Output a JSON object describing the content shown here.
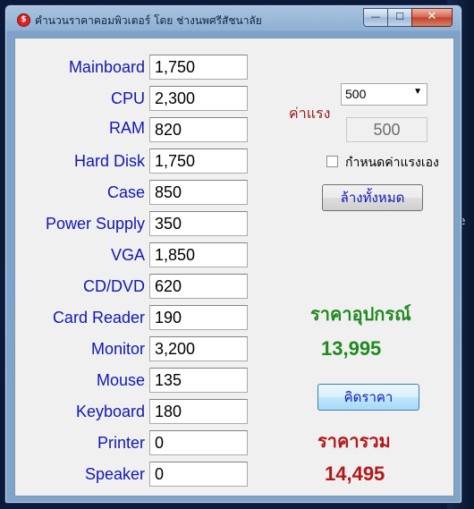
{
  "window": {
    "title": "คำนวนราคาคอมพิวเตอร์ โดย ช่างนพศรีสัชนาลัย",
    "icon_glyph": "$",
    "min_glyph": "—",
    "max_glyph": "☐",
    "close_glyph": "✕"
  },
  "background_glyph": "e",
  "components": [
    {
      "label": "Mainboard",
      "value": "1,750"
    },
    {
      "label": "CPU",
      "value": "2,300"
    },
    {
      "label": "RAM",
      "value": "820"
    },
    {
      "label": "Hard Disk",
      "value": "1,750"
    },
    {
      "label": "Case",
      "value": "850"
    },
    {
      "label": "Power Supply",
      "value": "350"
    },
    {
      "label": "VGA",
      "value": "1,850"
    },
    {
      "label": "CD/DVD",
      "value": "620"
    },
    {
      "label": "Card Reader",
      "value": "190"
    },
    {
      "label": "Monitor",
      "value": "3,200"
    },
    {
      "label": "Mouse",
      "value": "135"
    },
    {
      "label": "Keyboard",
      "value": "180"
    },
    {
      "label": "Printer",
      "value": "0"
    },
    {
      "label": "Speaker",
      "value": "0"
    }
  ],
  "labor": {
    "label": "ค่าแรง",
    "selected": "500",
    "display": "500",
    "custom_checkbox_label": "กำหนดค่าแรงเอง",
    "custom_checked": false
  },
  "buttons": {
    "clear": "ล้างทั้งหมด",
    "calculate": "คิดราคา"
  },
  "equipment": {
    "label": "ราคาอุปกรณ์",
    "value": "13,995"
  },
  "total": {
    "label": "ราคารวม",
    "value": "14,495"
  },
  "colors": {
    "label_blue": "#1018b8",
    "green": "#1f8a1f",
    "red": "#b41818"
  }
}
